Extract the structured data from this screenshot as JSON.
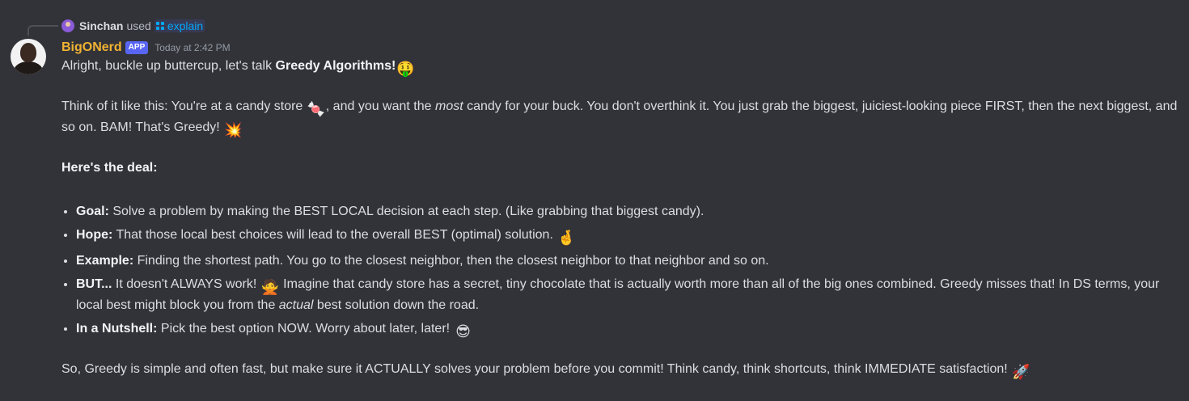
{
  "interaction": {
    "user": "Sinchan",
    "used": "used",
    "command": "explain"
  },
  "author": {
    "name": "BigONerd",
    "badge": "APP",
    "timestamp": "Today at 2:42 PM",
    "name_color": "#f0b232"
  },
  "message": {
    "intro_text": "Alright, buckle up buttercup, let's talk ",
    "intro_bold": "Greedy Algorithms!",
    "intro_emoji": "🤑",
    "p2_a": "Think of it like this: You're at a candy store ",
    "p2_emoji1": "🍬",
    "p2_b": ", and you want the ",
    "p2_italic": "most",
    "p2_c": " candy for your buck. You don't overthink it. You just grab the biggest, juiciest-looking piece FIRST, then the next biggest, and so on. BAM! That's Greedy! ",
    "p2_emoji2": "💥",
    "deal_heading": "Here's the deal:",
    "bullets": [
      {
        "label": "Goal:",
        "text": " Solve a problem by making the BEST LOCAL decision at each step. (Like grabbing that biggest candy)."
      },
      {
        "label": "Hope:",
        "text": " That those local best choices will lead to the overall BEST (optimal) solution. ",
        "emoji": "🤞"
      },
      {
        "label": "Example:",
        "text": " Finding the shortest path. You go to the closest neighbor, then the closest neighbor to that neighbor and so on."
      },
      {
        "label": "BUT...",
        "text_a": " It doesn't ALWAYS work! ",
        "emoji": "🙅",
        "text_b": " Imagine that candy store has a secret, tiny chocolate that is actually worth more than all of the big ones combined. Greedy misses that! In DS terms, your local best might block you from the ",
        "italic": "actual",
        "text_c": " best solution down the road."
      },
      {
        "label": "In a Nutshell:",
        "text": " Pick the best option NOW. Worry about later, later! ",
        "emoji": "😎"
      }
    ],
    "outro": "So, Greedy is simple and often fast, but make sure it ACTUALLY solves your problem before you commit! Think candy, think shortcuts, think IMMEDIATE satisfaction! ",
    "outro_emoji": "🚀"
  },
  "colors": {
    "background": "#323339",
    "text": "#dbdee1",
    "command": "#00a8fc",
    "badge": "#5865f2",
    "timestamp": "#949ba4"
  }
}
